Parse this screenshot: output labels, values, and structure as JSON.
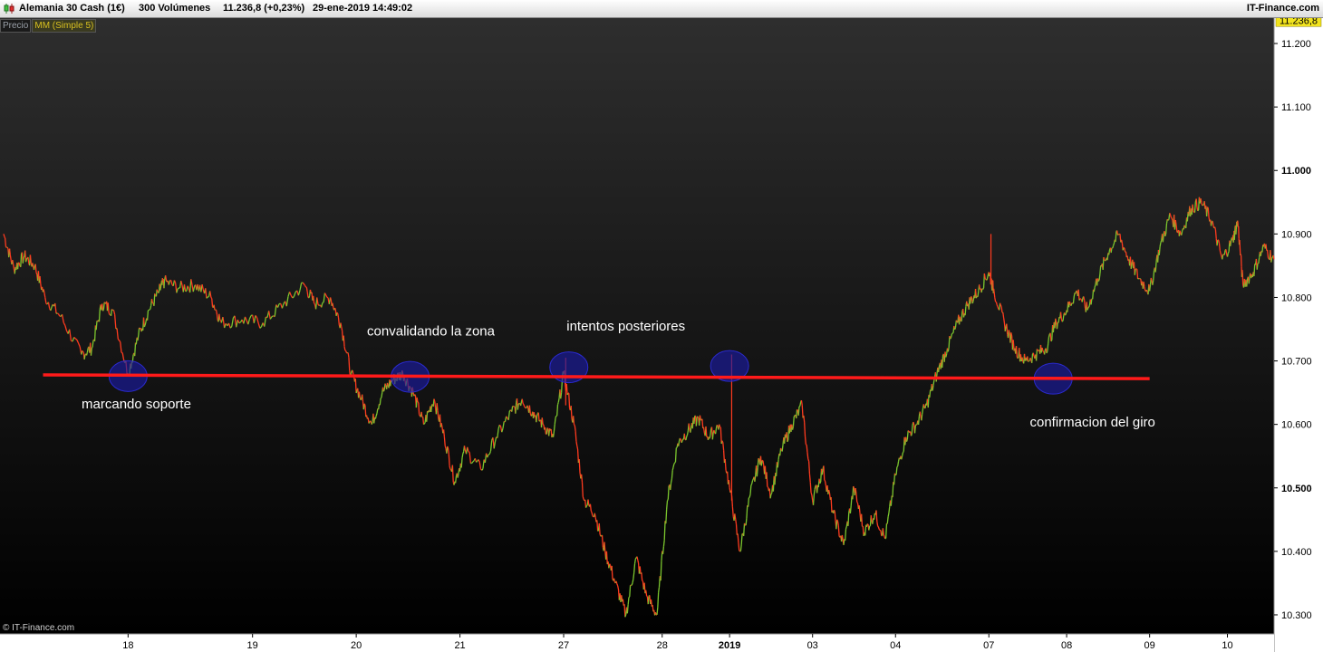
{
  "header": {
    "instrument": "Alemania 30 Cash (1€)",
    "volume": "300 Volúmenes",
    "price_change": "11.236,8 (+0,23%)",
    "datetime": "29-ene-2019 14:49:02",
    "brand": "IT-Finance.com"
  },
  "legend": {
    "price_label": "Precio",
    "ma_label": "MM (Simple 5)"
  },
  "watermark": "© IT-Finance.com",
  "colors": {
    "background": "#000000",
    "up": "#7bc62e",
    "down": "#ff3b1f",
    "support_line": "#ff1a1a",
    "ellipse": "#1a1aa0"
  },
  "chart_data": {
    "type": "line",
    "title": "",
    "ylim": [
      10270,
      11240
    ],
    "last_price": 11236.8,
    "last_price_label": "11.236,8",
    "y_ticks": [
      {
        "value": 11200,
        "label": "11.200",
        "bold": false
      },
      {
        "value": 11100,
        "label": "11.100",
        "bold": false
      },
      {
        "value": 11000,
        "label": "11.000",
        "bold": true
      },
      {
        "value": 10900,
        "label": "10.900",
        "bold": false
      },
      {
        "value": 10800,
        "label": "10.800",
        "bold": false
      },
      {
        "value": 10700,
        "label": "10.700",
        "bold": false
      },
      {
        "value": 10600,
        "label": "10.600",
        "bold": false
      },
      {
        "value": 10500,
        "label": "10.500",
        "bold": true
      },
      {
        "value": 10400,
        "label": "10.400",
        "bold": false
      },
      {
        "value": 10300,
        "label": "10.300",
        "bold": false
      }
    ],
    "x_ticks": [
      {
        "label": "18",
        "t": 1.2,
        "bold": false
      },
      {
        "label": "19",
        "t": 2.4,
        "bold": false
      },
      {
        "label": "20",
        "t": 3.4,
        "bold": false
      },
      {
        "label": "21",
        "t": 4.4,
        "bold": false
      },
      {
        "label": "27",
        "t": 5.4,
        "bold": false
      },
      {
        "label": "28",
        "t": 6.35,
        "bold": false
      },
      {
        "label": "2019",
        "t": 7.0,
        "bold": true
      },
      {
        "label": "03",
        "t": 7.8,
        "bold": false
      },
      {
        "label": "04",
        "t": 8.6,
        "bold": false
      },
      {
        "label": "07",
        "t": 9.5,
        "bold": false
      },
      {
        "label": "08",
        "t": 10.25,
        "bold": false
      },
      {
        "label": "09",
        "t": 11.05,
        "bold": false
      },
      {
        "label": "10",
        "t": 11.8,
        "bold": false
      }
    ],
    "t_range": [
      0,
      12.25
    ],
    "series": [
      {
        "points": [
          [
            0,
            10900
          ],
          [
            0.1,
            10845
          ],
          [
            0.2,
            10865
          ],
          [
            0.3,
            10850
          ],
          [
            0.4,
            10800
          ],
          [
            0.55,
            10770
          ],
          [
            0.75,
            10710
          ],
          [
            0.85,
            10720
          ],
          [
            0.95,
            10790
          ],
          [
            1.05,
            10780
          ],
          [
            1.2,
            10680
          ],
          [
            1.3,
            10740
          ],
          [
            1.4,
            10780
          ],
          [
            1.5,
            10810
          ],
          [
            1.55,
            10825
          ],
          [
            1.7,
            10815
          ],
          [
            1.85,
            10820
          ],
          [
            2.0,
            10800
          ],
          [
            2.1,
            10760
          ],
          [
            2.3,
            10765
          ],
          [
            2.5,
            10760
          ],
          [
            2.7,
            10790
          ],
          [
            2.9,
            10820
          ],
          [
            3.0,
            10790
          ],
          [
            3.15,
            10800
          ],
          [
            3.25,
            10760
          ],
          [
            3.35,
            10680
          ],
          [
            3.45,
            10640
          ],
          [
            3.55,
            10600
          ],
          [
            3.65,
            10650
          ],
          [
            3.75,
            10670
          ],
          [
            3.85,
            10680
          ],
          [
            3.95,
            10650
          ],
          [
            4.05,
            10600
          ],
          [
            4.15,
            10640
          ],
          [
            4.25,
            10580
          ],
          [
            4.35,
            10510
          ],
          [
            4.45,
            10560
          ],
          [
            4.6,
            10530
          ],
          [
            4.75,
            10580
          ],
          [
            4.9,
            10620
          ],
          [
            5.0,
            10640
          ],
          [
            5.1,
            10620
          ],
          [
            5.2,
            10600
          ],
          [
            5.3,
            10580
          ],
          [
            5.4,
            10680
          ],
          [
            5.5,
            10600
          ],
          [
            5.6,
            10480
          ],
          [
            5.7,
            10460
          ],
          [
            5.8,
            10400
          ],
          [
            5.9,
            10350
          ],
          [
            6.0,
            10300
          ],
          [
            6.1,
            10390
          ],
          [
            6.2,
            10330
          ],
          [
            6.3,
            10300
          ],
          [
            6.4,
            10480
          ],
          [
            6.5,
            10570
          ],
          [
            6.6,
            10590
          ],
          [
            6.7,
            10610
          ],
          [
            6.8,
            10580
          ],
          [
            6.9,
            10600
          ],
          [
            7.0,
            10500
          ],
          [
            7.1,
            10400
          ],
          [
            7.2,
            10490
          ],
          [
            7.3,
            10550
          ],
          [
            7.4,
            10490
          ],
          [
            7.5,
            10560
          ],
          [
            7.6,
            10600
          ],
          [
            7.7,
            10630
          ],
          [
            7.8,
            10480
          ],
          [
            7.9,
            10530
          ],
          [
            8.0,
            10460
          ],
          [
            8.1,
            10410
          ],
          [
            8.2,
            10500
          ],
          [
            8.3,
            10430
          ],
          [
            8.4,
            10460
          ],
          [
            8.5,
            10420
          ],
          [
            8.6,
            10520
          ],
          [
            8.7,
            10580
          ],
          [
            8.8,
            10600
          ],
          [
            8.9,
            10630
          ],
          [
            9.0,
            10680
          ],
          [
            9.1,
            10720
          ],
          [
            9.2,
            10760
          ],
          [
            9.3,
            10790
          ],
          [
            9.4,
            10810
          ],
          [
            9.5,
            10840
          ],
          [
            9.55,
            10810
          ],
          [
            9.65,
            10760
          ],
          [
            9.75,
            10720
          ],
          [
            9.85,
            10700
          ],
          [
            9.95,
            10710
          ],
          [
            10.05,
            10720
          ],
          [
            10.15,
            10760
          ],
          [
            10.25,
            10780
          ],
          [
            10.35,
            10810
          ],
          [
            10.45,
            10780
          ],
          [
            10.55,
            10830
          ],
          [
            10.65,
            10870
          ],
          [
            10.75,
            10900
          ],
          [
            10.85,
            10860
          ],
          [
            10.95,
            10830
          ],
          [
            11.05,
            10810
          ],
          [
            11.15,
            10880
          ],
          [
            11.25,
            10930
          ],
          [
            11.35,
            10900
          ],
          [
            11.45,
            10940
          ],
          [
            11.55,
            10950
          ],
          [
            11.65,
            10920
          ],
          [
            11.75,
            10860
          ],
          [
            11.85,
            10890
          ],
          [
            11.9,
            10920
          ],
          [
            11.95,
            10820
          ],
          [
            12.05,
            10840
          ],
          [
            12.15,
            10880
          ],
          [
            12.25,
            10860
          ]
        ]
      }
    ],
    "spikes": [
      {
        "t": 5.42,
        "high": 10705,
        "low": 10630
      },
      {
        "t": 7.02,
        "high": 10710,
        "low": 10480
      },
      {
        "t": 9.52,
        "high": 10900,
        "low": 10820
      }
    ],
    "support_line": {
      "t1": 0.38,
      "v1": 10678,
      "t2": 11.05,
      "v2": 10672
    },
    "ellipses": [
      {
        "t": 1.2,
        "v": 10676
      },
      {
        "t": 3.92,
        "v": 10675
      },
      {
        "t": 5.45,
        "v": 10690
      },
      {
        "t": 7.0,
        "v": 10692
      },
      {
        "t": 10.12,
        "v": 10672
      }
    ],
    "annotations": [
      {
        "text": "marcando soporte",
        "t": 1.28,
        "v": 10625
      },
      {
        "text": "convalidando la zona",
        "t": 4.12,
        "v": 10740
      },
      {
        "text": "intentos posteriores",
        "t": 6.0,
        "v": 10748
      },
      {
        "text": "confirmacion del giro",
        "t": 10.5,
        "v": 10597
      }
    ]
  }
}
